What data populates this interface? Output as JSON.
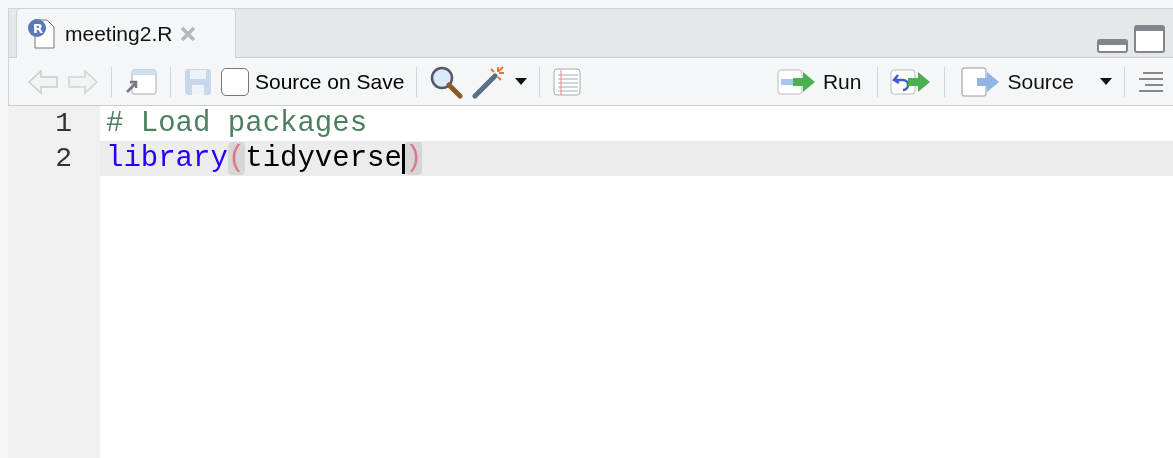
{
  "tab": {
    "icon_letter": "R",
    "title": "meeting2.R",
    "selected": true
  },
  "toolbar": {
    "back": {
      "disabled": true
    },
    "forward": {
      "disabled": true
    },
    "save": {
      "disabled": true
    },
    "source_on_save": {
      "label": "Source on Save",
      "checked": false
    },
    "run": {
      "label": "Run"
    },
    "source": {
      "label": "Source"
    }
  },
  "editor": {
    "lines": [
      {
        "number": "1",
        "active": false,
        "tokens": [
          {
            "kind": "comment",
            "text": "# Load packages"
          }
        ]
      },
      {
        "number": "2",
        "active": true,
        "tokens": [
          {
            "kind": "function",
            "text": "library"
          },
          {
            "kind": "paren",
            "text": "(",
            "matched": true
          },
          {
            "kind": "plain",
            "text": "tidyverse"
          },
          {
            "kind": "cursor"
          },
          {
            "kind": "paren",
            "text": ")",
            "matched": true
          }
        ]
      }
    ]
  }
}
